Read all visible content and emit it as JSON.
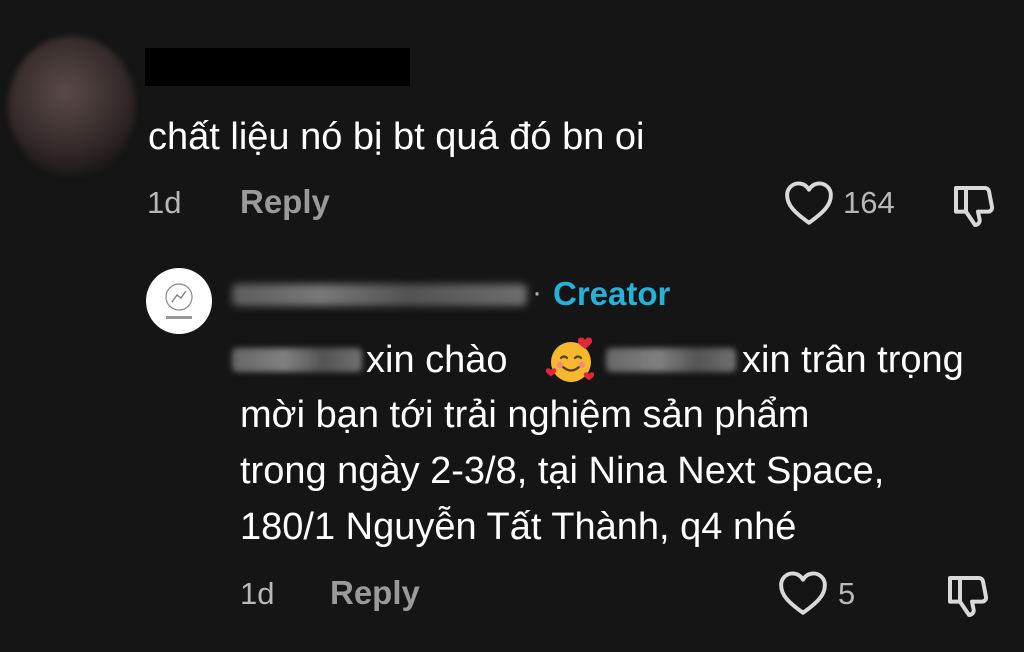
{
  "comment": {
    "text": "chất liệu nó bị bt quá đó bn oi",
    "time": "1d",
    "reply_label": "Reply",
    "like_count": "164"
  },
  "reply": {
    "badge": "Creator",
    "separator": "·",
    "line1_part1": "xin chào",
    "line1_part2": "xin trân trọng",
    "line2": "mời bạn tới trải nghiệm sản phẩm",
    "line3": "trong ngày 2-3/8, tại Nina Next Space,",
    "line4": "180/1 Nguyễn Tất Thành, q4 nhé",
    "time": "1d",
    "reply_label": "Reply",
    "like_count": "5"
  },
  "icons": {
    "like": "heart-outline",
    "dislike": "thumbs-down-outline",
    "emoji": "smiling-face-with-hearts"
  },
  "colors": {
    "background": "#151515",
    "creator_badge": "#27b0d8",
    "secondary_text": "#b8b8b8"
  }
}
